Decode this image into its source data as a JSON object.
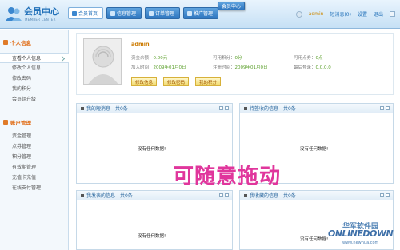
{
  "header": {
    "title": "会员中心",
    "subtitle": "MEMBER CENTER",
    "tabs": [
      {
        "label": "会员首页",
        "active": true
      },
      {
        "label": "信息管理",
        "active": false
      },
      {
        "label": "订单管理",
        "active": false
      },
      {
        "label": "推广管理",
        "active": false
      }
    ],
    "dragging_tab": "会员中心",
    "username": "admin",
    "messages_label": "短消息(0)",
    "settings_label": "设置",
    "exit_label": "退出"
  },
  "sidebar": {
    "sections": [
      {
        "title": "个人信息",
        "items": [
          "查看个人信息",
          "修改个人信息",
          "修改密码",
          "我的积分",
          "会员组升级"
        ]
      },
      {
        "title": "账户管理",
        "items": [
          "资金管理",
          "点券管理",
          "积分管理",
          "有效期管理",
          "充值卡充值",
          "在线支付管理"
        ]
      }
    ]
  },
  "profile": {
    "name": "admin",
    "fields": [
      {
        "label": "资金余额：",
        "value": "0.00元"
      },
      {
        "label": "可用积分：",
        "value": "0分"
      },
      {
        "label": "可用点券：",
        "value": "0点"
      },
      {
        "label": "加入时间：",
        "value": "2009年01月0日"
      },
      {
        "label": "注册时间：",
        "value": "2009年01月0日"
      },
      {
        "label": "最后登录：",
        "value": "0.0.0.0"
      }
    ],
    "buttons": [
      "修改信息",
      "修改密码",
      "我的积分"
    ]
  },
  "panels": [
    {
      "title": "我的短消息 - 共0条",
      "empty": "没有任何数据!"
    },
    {
      "title": "待签收的信息 - 共0条",
      "empty": "没有任何数据!"
    },
    {
      "title": "我发表的信息 - 共0条",
      "empty": "没有任何数据!"
    },
    {
      "title": "我收藏的信息 - 共0条",
      "empty": "没有任何数据!"
    }
  ],
  "overlay_text": "可随意拖动",
  "watermark": {
    "line1": "华军软件园",
    "line2": "ONLINEDOWN",
    "line3": "www.newhua.com"
  }
}
